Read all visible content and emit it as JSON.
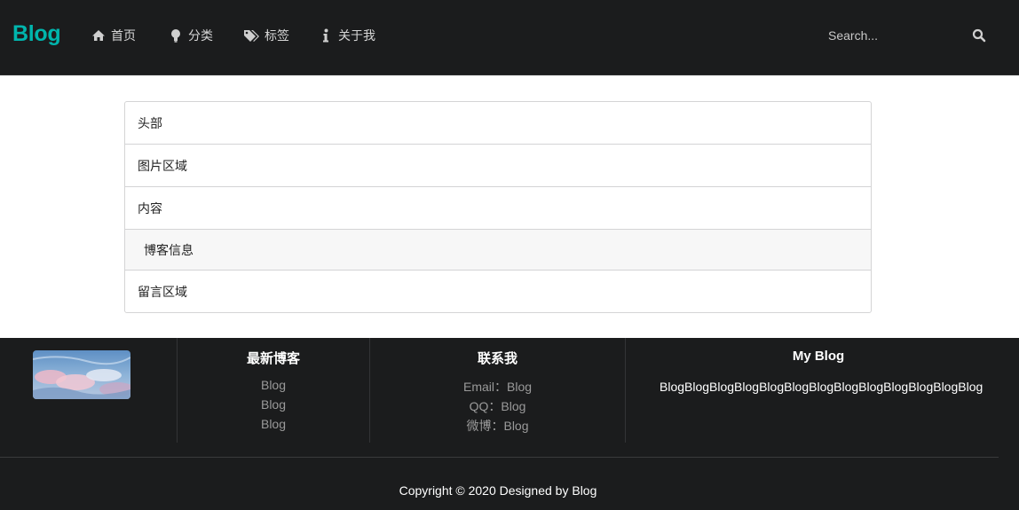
{
  "header": {
    "brand": "Blog",
    "nav": [
      {
        "label": "首页",
        "icon": "home-icon"
      },
      {
        "label": "分类",
        "icon": "lightbulb-icon"
      },
      {
        "label": "标签",
        "icon": "tags-icon"
      },
      {
        "label": "关于我",
        "icon": "info-icon"
      }
    ],
    "search": {
      "placeholder": "Search...",
      "icon": "search-icon"
    }
  },
  "sections": [
    {
      "label": "头部"
    },
    {
      "label": "图片区域"
    },
    {
      "label": "内容"
    },
    {
      "label": "博客信息"
    },
    {
      "label": "留言区域"
    }
  ],
  "footer": {
    "image": "landscape-thumbnail",
    "latest": {
      "title": "最新博客",
      "items": [
        "Blog",
        "Blog",
        "Blog"
      ]
    },
    "contact": {
      "title": "联系我",
      "items": [
        "Email：Blog",
        "QQ：Blog",
        "微博：Blog"
      ]
    },
    "about": {
      "title": "My Blog",
      "text": "BlogBlogBlogBlogBlogBlogBlogBlogBlogBlogBlogBlogBlog"
    },
    "copyright": "Copyright © 2020 Designed by Blog"
  },
  "colors": {
    "brand": "#00b5ad",
    "dark": "#1b1c1d"
  }
}
